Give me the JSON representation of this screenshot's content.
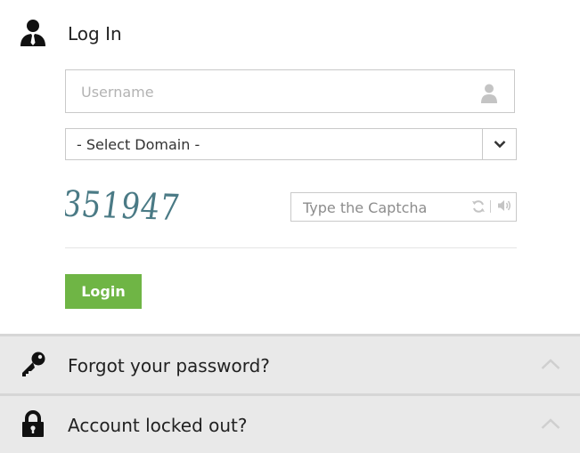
{
  "login": {
    "title": "Log In",
    "icon": "user-tie-icon",
    "username": {
      "placeholder": "Username",
      "value": "",
      "icon": "user-icon"
    },
    "domain": {
      "selected": "- Select Domain -",
      "icon": "chevron-down-icon"
    },
    "captcha": {
      "image_text": "351947",
      "placeholder": "Type the Captcha",
      "value": "",
      "icons": [
        "refresh-icon",
        "audio-icon"
      ]
    },
    "button_label": "Login"
  },
  "panels": {
    "forgot": {
      "title": "Forgot your password?",
      "icon": "key-icon",
      "toggle_icon": "chevron-up-icon"
    },
    "locked": {
      "title": "Account locked out?",
      "icon": "lock-icon",
      "toggle_icon": "chevron-up-icon"
    }
  },
  "colors": {
    "accent_green": "#6fb545",
    "captcha_text": "#4a7a85",
    "panel_bg": "#e9e9e9",
    "border": "#c9c9c9"
  }
}
